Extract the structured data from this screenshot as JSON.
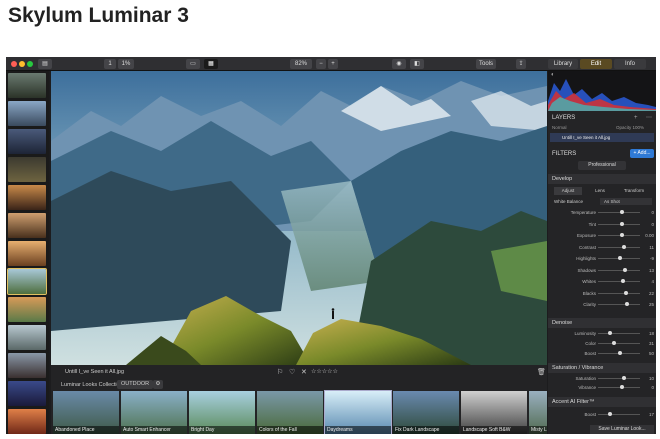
{
  "page_title": "Skylum Luminar 3",
  "toolbar": {
    "zoom_step": "1",
    "zoom_percent": "1%",
    "zoom_level": "82%",
    "tools_label": "Tools",
    "tabs": [
      "Library",
      "Edit",
      "Info"
    ]
  },
  "image": {
    "filename": "Untill I_ve Seen it All.jpg",
    "rating_symbol": "☆☆☆☆☆"
  },
  "looks_bar": {
    "collection_label": "Luminar Looks Collection:",
    "collection_value": "OUTDOOR",
    "looks": [
      "Abandoned Place",
      "Auto Smart Enhancer",
      "Bright Day",
      "Colors of the Fall",
      "Daydreams",
      "Fix Dark Landscape",
      "Landscape Soft B&W",
      "Misty Lan"
    ]
  },
  "panel": {
    "layers_title": "LAYERS",
    "normal_label": "Normal",
    "opacity_label": "Opacity 100%",
    "layer_name": "Untill I_ve Seen it All.jpg",
    "filters_title": "FILTERS",
    "add_button": "+ Add...",
    "workspace": "Professional",
    "develop": {
      "title": "Develop",
      "tabs": [
        "Adjust",
        "Lens",
        "Transform"
      ],
      "white_balance_label": "White Balance",
      "white_balance_value": "As Shot",
      "rows": [
        {
          "label": "Temperature",
          "value": "0",
          "pos": 0.55
        },
        {
          "label": "Tint",
          "value": "0",
          "pos": 0.55
        },
        {
          "label": "Exposure",
          "value": "0.00",
          "pos": 0.55
        },
        {
          "label": "Contrast",
          "value": "11",
          "pos": 0.6
        },
        {
          "label": "Highlights",
          "value": "-9",
          "pos": 0.5
        },
        {
          "label": "Shadows",
          "value": "13",
          "pos": 0.62
        },
        {
          "label": "Whites",
          "value": "4",
          "pos": 0.57
        },
        {
          "label": "Blacks",
          "value": "22",
          "pos": 0.66
        },
        {
          "label": "Clarity",
          "value": "25",
          "pos": 0.68
        }
      ]
    },
    "denoise": {
      "title": "Denoise",
      "rows": [
        {
          "label": "Luminosity",
          "value": "18",
          "pos": 0.25
        },
        {
          "label": "Color",
          "value": "31",
          "pos": 0.35
        },
        {
          "label": "Boost",
          "value": "50",
          "pos": 0.5
        }
      ]
    },
    "saturation": {
      "title": "Saturation / Vibrance",
      "rows": [
        {
          "label": "Saturation",
          "value": "10",
          "pos": 0.6
        },
        {
          "label": "Vibrance",
          "value": "0",
          "pos": 0.55
        }
      ]
    },
    "accent": {
      "title": "Accent AI Filter™",
      "rows": [
        {
          "label": "Boost",
          "value": "17",
          "pos": 0.25
        }
      ]
    },
    "save_look_button": "Save Luminar Look..."
  },
  "colors": {
    "accent_blue": "#2f7ad6",
    "edit_tab_active": "#5a4a22",
    "window_bg": "#1c1c1e"
  }
}
